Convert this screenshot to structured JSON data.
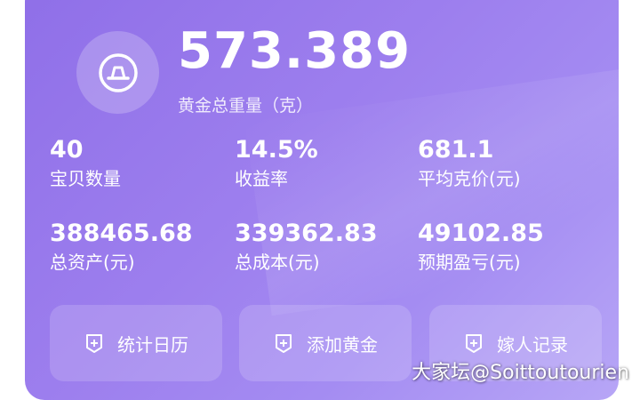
{
  "summary": {
    "total_weight_value": "573.389",
    "total_weight_label": "黄金总重量（克）"
  },
  "stats": [
    {
      "value": "40",
      "label": "宝贝数量"
    },
    {
      "value": "14.5%",
      "label": "收益率"
    },
    {
      "value": "681.1",
      "label": "平均克价(元)"
    },
    {
      "value": "388465.68",
      "label": "总资产(元)"
    },
    {
      "value": "339362.83",
      "label": "总成本(元)"
    },
    {
      "value": "49102.85",
      "label": "预期盈亏(元)"
    }
  ],
  "actions": [
    {
      "label": "统计日历",
      "icon": "plus-square-icon"
    },
    {
      "label": "添加黄金",
      "icon": "plus-square-icon"
    },
    {
      "label": "嫁人记录",
      "icon": "plus-square-icon"
    }
  ],
  "avatar_icon": "gold-bar-icon",
  "watermark": "大家坛@Soittoutourien",
  "colors": {
    "card_gradient_start": "#8f6fe8",
    "card_gradient_end": "#b7a6f6",
    "text": "#ffffff"
  }
}
